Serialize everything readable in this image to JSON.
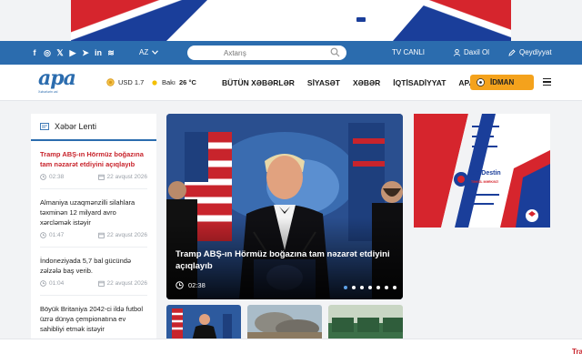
{
  "topbar": {
    "socials": [
      "f",
      "◎",
      "𝕏",
      "▶",
      "➤",
      "in",
      "≋"
    ],
    "language": "AZ",
    "search_placeholder": "Axtarış",
    "tv_label": "TV CANLI",
    "login_label": "Daxil Ol",
    "register_label": "Qeydiyyat"
  },
  "navbar": {
    "logo_text": "apa",
    "logo_tagline": "Xəbərlərin əsl",
    "currency": "USD 1.7",
    "weather_city": "Bakı",
    "weather_temp": "26 °C",
    "menu": [
      "BÜTÜN XƏBƏRLƏR",
      "SİYASƏT",
      "XƏBƏR",
      "İQTİSADİYYAT",
      "APA TV"
    ],
    "sport_label": "İDMAN"
  },
  "feed": {
    "title": "Xəbər Lenti",
    "items": [
      {
        "title": "Tramp ABŞ-ın Hörmüz boğazına tam nəzarət etdiyini açıqlayıb",
        "time": "02:38",
        "date": "22 avqust 2026"
      },
      {
        "title": "Almaniya uzaqmənzilli silahlara təxminən 12 milyard avro xərcləmək istəyir",
        "time": "01:47",
        "date": "22 avqust 2026"
      },
      {
        "title": "İndoneziyada 5,7 bal gücündə zəlzələ baş verib.",
        "time": "01:04",
        "date": "22 avqust 2026"
      },
      {
        "title": "Böyük Britaniya 2042-ci ildə futbol üzrə dünya çempionatına ev sahibliyi etmək istəyir",
        "time": "",
        "date": ""
      }
    ]
  },
  "hero": {
    "headline": "Tramp ABŞ-ın Hörmüz boğazına tam nəzarət etdiyini açıqlayıb",
    "time": "02:38",
    "slide_count": 7,
    "active_slide": 1
  },
  "ad_right": {
    "brand": "UniDestin",
    "subtitle": "TƏHSİL MƏRKƏZİ"
  },
  "bottom": {
    "ticker": "Tra"
  },
  "colors": {
    "primary_blue": "#2b6cae",
    "accent_red": "#c8242c",
    "sport_orange": "#f4a21c"
  }
}
